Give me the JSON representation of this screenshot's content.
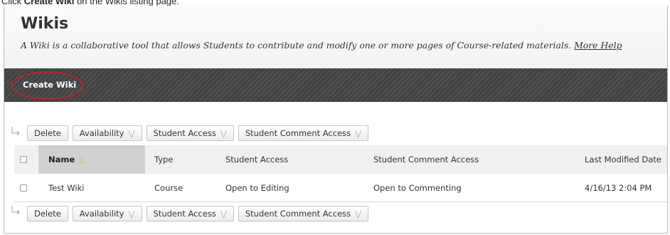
{
  "caption": {
    "prefix": "Click ",
    "bold": "Create Wiki",
    "suffix": " on the Wikis listing page."
  },
  "page": {
    "title": "Wikis",
    "description": "A Wiki is a collaborative tool that allows Students to contribute and modify one or more pages of Course-related materials.",
    "help_link": "More Help"
  },
  "actionbar": {
    "create_label": "Create Wiki"
  },
  "bulk_actions": {
    "delete": "Delete",
    "availability": "Availability",
    "student_access": "Student Access",
    "student_comment_access": "Student Comment Access"
  },
  "table": {
    "columns": [
      "Name",
      "Type",
      "Student Access",
      "Student Comment Access",
      "Last Modified Date"
    ],
    "sorted_column": "Name",
    "sort_direction": "ascending",
    "rows": [
      {
        "name": "Test Wiki",
        "type": "Course",
        "student_access": "Open to Editing",
        "student_comment_access": "Open to Commenting",
        "last_modified": "4/16/13 2:04 PM"
      }
    ]
  },
  "colors": {
    "highlight_circle": "#b9272b",
    "action_bar": "#464646",
    "sort_arrow": "#d9b450"
  },
  "icons": {
    "sort": "sort-ascending-icon",
    "menu": "chevron-down-icon",
    "bulk": "bulk-arrow-icon"
  }
}
